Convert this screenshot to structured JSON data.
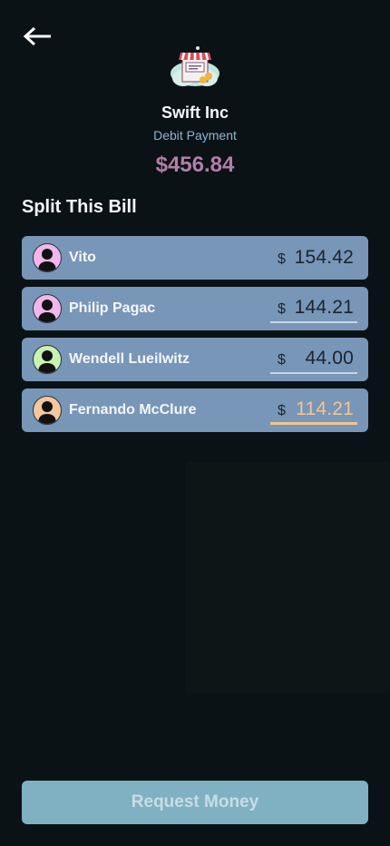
{
  "merchant": {
    "name": "Swift Inc",
    "payment_type": "Debit Payment",
    "total": "$456.84"
  },
  "split": {
    "title": "Split This Bill",
    "currency_symbol": "$",
    "people": [
      {
        "name": "Vito",
        "amount": "154.42",
        "avatar_color": "#f2b6ea"
      },
      {
        "name": "Philip Pagac",
        "amount": "144.21",
        "avatar_color": "#f2b6ea"
      },
      {
        "name": "Wendell Lueilwitz",
        "amount": "44.00",
        "avatar_color": "#c9f2b2"
      },
      {
        "name": "Fernando McClure",
        "amount": "114.21",
        "avatar_color": "#f6c79a"
      }
    ]
  },
  "actions": {
    "request_label": "Request Money"
  },
  "icons": {
    "back": "arrow-left-icon",
    "merchant": "storefront-icon",
    "avatar": "user-silhouette-icon"
  },
  "colors": {
    "background": "#0b1215",
    "row": "#7896b7",
    "accent_amount": "#f3c48e",
    "total": "#b27ea8",
    "button": "#7fb1c2"
  }
}
